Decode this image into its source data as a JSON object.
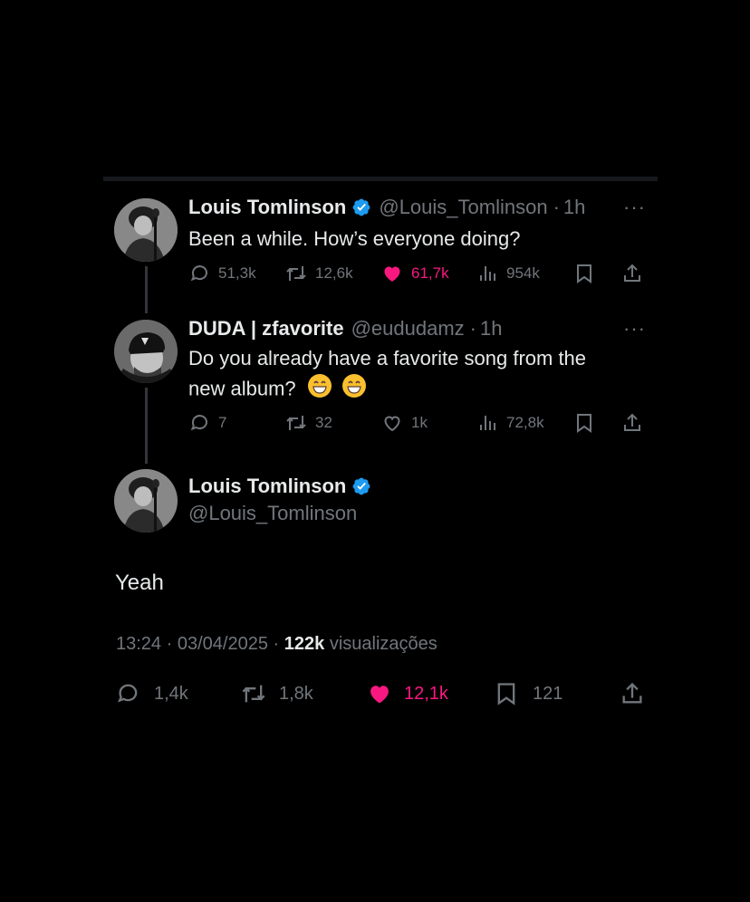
{
  "tweets": [
    {
      "name": "Louis Tomlinson",
      "handle": "@Louis_Tomlinson",
      "time": "1h",
      "text": "Been a while. How’s everyone doing?",
      "replies": "51,3k",
      "retweets": "12,6k",
      "likes": "61,7k",
      "views": "954k",
      "liked": true,
      "verified": true
    },
    {
      "name": "DUDA | zfavorite",
      "handle": "@eududamz",
      "time": "1h",
      "text_line1": "Do you already have a favorite song from the",
      "text_line2": "new album?",
      "emoji": "😁",
      "replies": "7",
      "retweets": "32",
      "likes": "1k",
      "views": "72,8k",
      "liked": false,
      "verified": false
    }
  ],
  "main_tweet": {
    "name": "Louis Tomlinson",
    "handle": "@Louis_Tomlinson",
    "text": "Yeah",
    "time": "13:24",
    "date": "03/04/2025",
    "views_count": "122k",
    "views_label": "visualizações",
    "replies": "1,4k",
    "retweets": "1,8k",
    "likes": "12,1k",
    "bookmarks": "121",
    "verified": true
  },
  "separator": "·",
  "more_glyph": "···",
  "colors": {
    "background": "#000000",
    "text": "#e7e9ea",
    "secondary": "#71767b",
    "like": "#f91880",
    "verified": "#1d9bf0"
  },
  "icons": [
    "reply-icon",
    "retweet-icon",
    "heart-icon",
    "views-icon",
    "bookmark-icon",
    "share-icon",
    "verified-badge-icon",
    "more-icon"
  ]
}
